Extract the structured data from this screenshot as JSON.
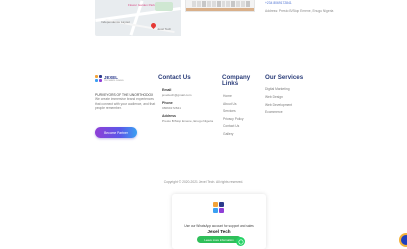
{
  "map": {
    "label_park": "Flower Garden Park",
    "label_area": "Independence Layout",
    "label_place": "Jexel Tech"
  },
  "top_contact": {
    "phone": "+234 8069172841",
    "address": "Address: Presto B/Stop Emene, Enugu Nigeria"
  },
  "brand": {
    "name": "JEXEL",
    "sub": "TECHNOLOGIES",
    "tagline_strong": "PURVEYORS OF THE UNORTHODOX",
    "tagline_rest": " We create immersive brand experiences that connect with your audience, and that people remember.",
    "partner_button": "Become Partner"
  },
  "contact": {
    "heading": "Contact Us",
    "email_label": "Email",
    "email_value": "jexeltech@gmail.com",
    "phone_label": "Phone",
    "phone_value": "08069172841",
    "address_label": "Address",
    "address_value": "Presto B/Stop Emene, Enugu Nigeria"
  },
  "company": {
    "heading_line1": "Company",
    "heading_line2": "Links",
    "links": [
      "Home",
      "About Us",
      "Services",
      "Privacy Policy",
      "Contact Us",
      "Gallery"
    ]
  },
  "services": {
    "heading": "Our Services",
    "items": [
      "Digital Marketing",
      "Web Design",
      "Web Development",
      "Ecommerce"
    ]
  },
  "copyright": "Copyright © 2020-2021 Jexel Tech. All rights reserved.",
  "whatsapp": {
    "message": "Use our WhatsApp account for support and sales",
    "name": "Jexel Tech",
    "button": "Leave more information"
  },
  "colors": {
    "heading": "#2c3e7a",
    "partner_gradient_start": "#8f3fd6",
    "partner_gradient_end": "#3aa0f2",
    "whatsapp": "#2fbf5a"
  },
  "icons": [
    "map-pin-icon",
    "jexel-logo-icon",
    "whatsapp-icon"
  ]
}
